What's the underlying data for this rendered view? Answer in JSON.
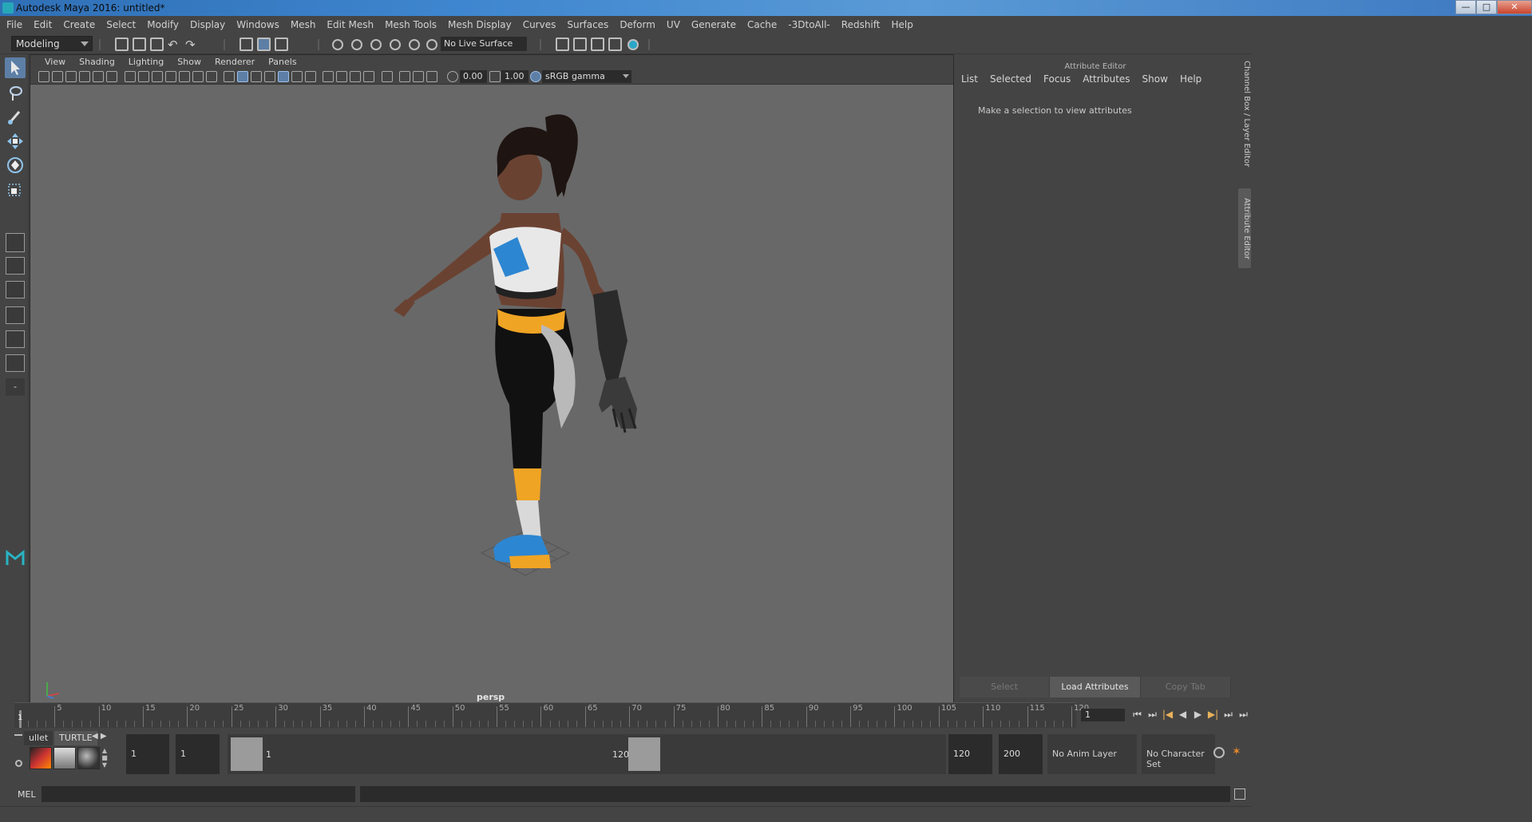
{
  "window": {
    "title": "Autodesk Maya 2016: untitled*",
    "buttons": {
      "minimize": "—",
      "maximize": "□",
      "close": "✕"
    }
  },
  "menu": [
    "File",
    "Edit",
    "Create",
    "Select",
    "Modify",
    "Display",
    "Windows",
    "Mesh",
    "Edit Mesh",
    "Mesh Tools",
    "Mesh Display",
    "Curves",
    "Surfaces",
    "Deform",
    "UV",
    "Generate",
    "Cache",
    "-3DtoAll-",
    "Redshift",
    "Help"
  ],
  "statusline": {
    "menu_set": "Modeling",
    "live_surface": "No Live Surface"
  },
  "viewport": {
    "menu": [
      "View",
      "Shading",
      "Lighting",
      "Show",
      "Renderer",
      "Panels"
    ],
    "exposure": "0.00",
    "gamma": "1.00",
    "color_space": "sRGB gamma",
    "camera_label": "persp",
    "axis_labels": {
      "x": "x",
      "y": "y",
      "z": "z"
    }
  },
  "attribute_editor": {
    "title": "Attribute Editor",
    "menu": [
      "List",
      "Selected",
      "Focus",
      "Attributes",
      "Show",
      "Help"
    ],
    "message": "Make a selection to view attributes",
    "footer": [
      "Select",
      "Load Attributes",
      "Copy Tab"
    ],
    "side_tabs": [
      "Channel Box / Layer Editor",
      "Attribute Editor"
    ]
  },
  "timeslider": {
    "start": 1,
    "end": 120,
    "tick_labels": [
      "5",
      "10",
      "15",
      "20",
      "25",
      "30",
      "35",
      "40",
      "45",
      "50",
      "55",
      "60",
      "65",
      "70",
      "75",
      "80",
      "85",
      "90",
      "95",
      "100",
      "105",
      "110",
      "115",
      "120"
    ],
    "current_frame_label": "1",
    "current_frame_field": "1",
    "playback_buttons": [
      "⏮",
      "⏭",
      "|◀",
      "◀",
      "▶",
      "▶|",
      "⏭",
      "⏭"
    ]
  },
  "shelf": {
    "tabs": [
      "ullet",
      "TURTLE"
    ],
    "arrows": "◀ ▶"
  },
  "range": {
    "start_field": "1",
    "playback_start": "1",
    "handle_start_label": "1",
    "handle_end_label": "120",
    "playback_end": "120",
    "end_field": "200",
    "anim_layer": "No Anim Layer",
    "character_set": "No Character Set"
  },
  "command_line": {
    "label": "MEL"
  },
  "colors": {
    "accent": "#5d7fa6",
    "viewport_bg": "#686868",
    "panel_bg": "#444444"
  }
}
